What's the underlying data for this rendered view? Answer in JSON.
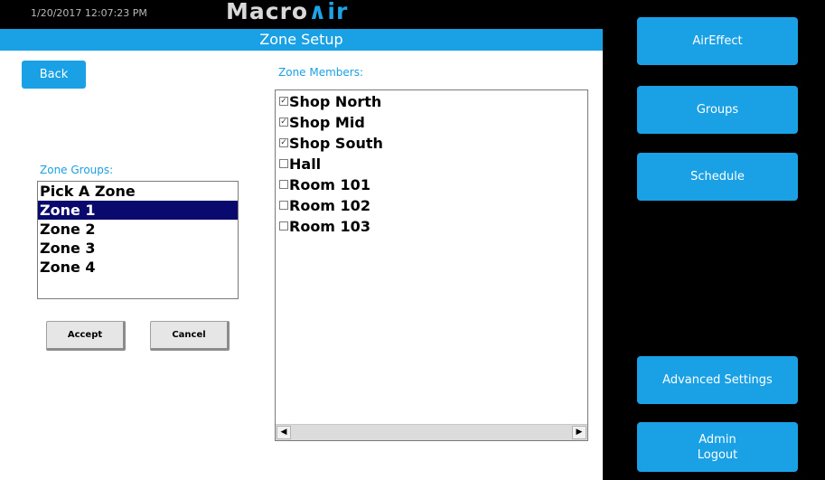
{
  "header": {
    "datetime": "1/20/2017 12:07:23 PM",
    "logo_text": "Macro",
    "logo_accent": "∧ir",
    "title": "Zone Setup"
  },
  "colors": {
    "accent": "#1aa0e5",
    "selected_row": "#0a0a6e",
    "sidebar_bg": "#000000"
  },
  "back_label": "Back",
  "zone_groups": {
    "label": "Zone Groups:",
    "items": [
      {
        "label": "Pick A Zone",
        "selected": false
      },
      {
        "label": "Zone 1",
        "selected": true
      },
      {
        "label": "Zone 2",
        "selected": false
      },
      {
        "label": "Zone 3",
        "selected": false
      },
      {
        "label": "Zone 4",
        "selected": false
      }
    ]
  },
  "buttons": {
    "accept": "Accept",
    "cancel": "Cancel"
  },
  "zone_members": {
    "label": "Zone Members:",
    "items": [
      {
        "label": "Shop North",
        "checked": true
      },
      {
        "label": "Shop Mid",
        "checked": true
      },
      {
        "label": "Shop South",
        "checked": true
      },
      {
        "label": "Hall",
        "checked": false
      },
      {
        "label": "Room 101",
        "checked": false
      },
      {
        "label": "Room 102",
        "checked": false
      },
      {
        "label": "Room 103",
        "checked": false
      }
    ]
  },
  "nav": {
    "aireffect": "AirEffect",
    "groups": "Groups",
    "schedule": "Schedule",
    "advanced": "Advanced Settings",
    "logout_line1": "Admin",
    "logout_line2": "Logout"
  }
}
